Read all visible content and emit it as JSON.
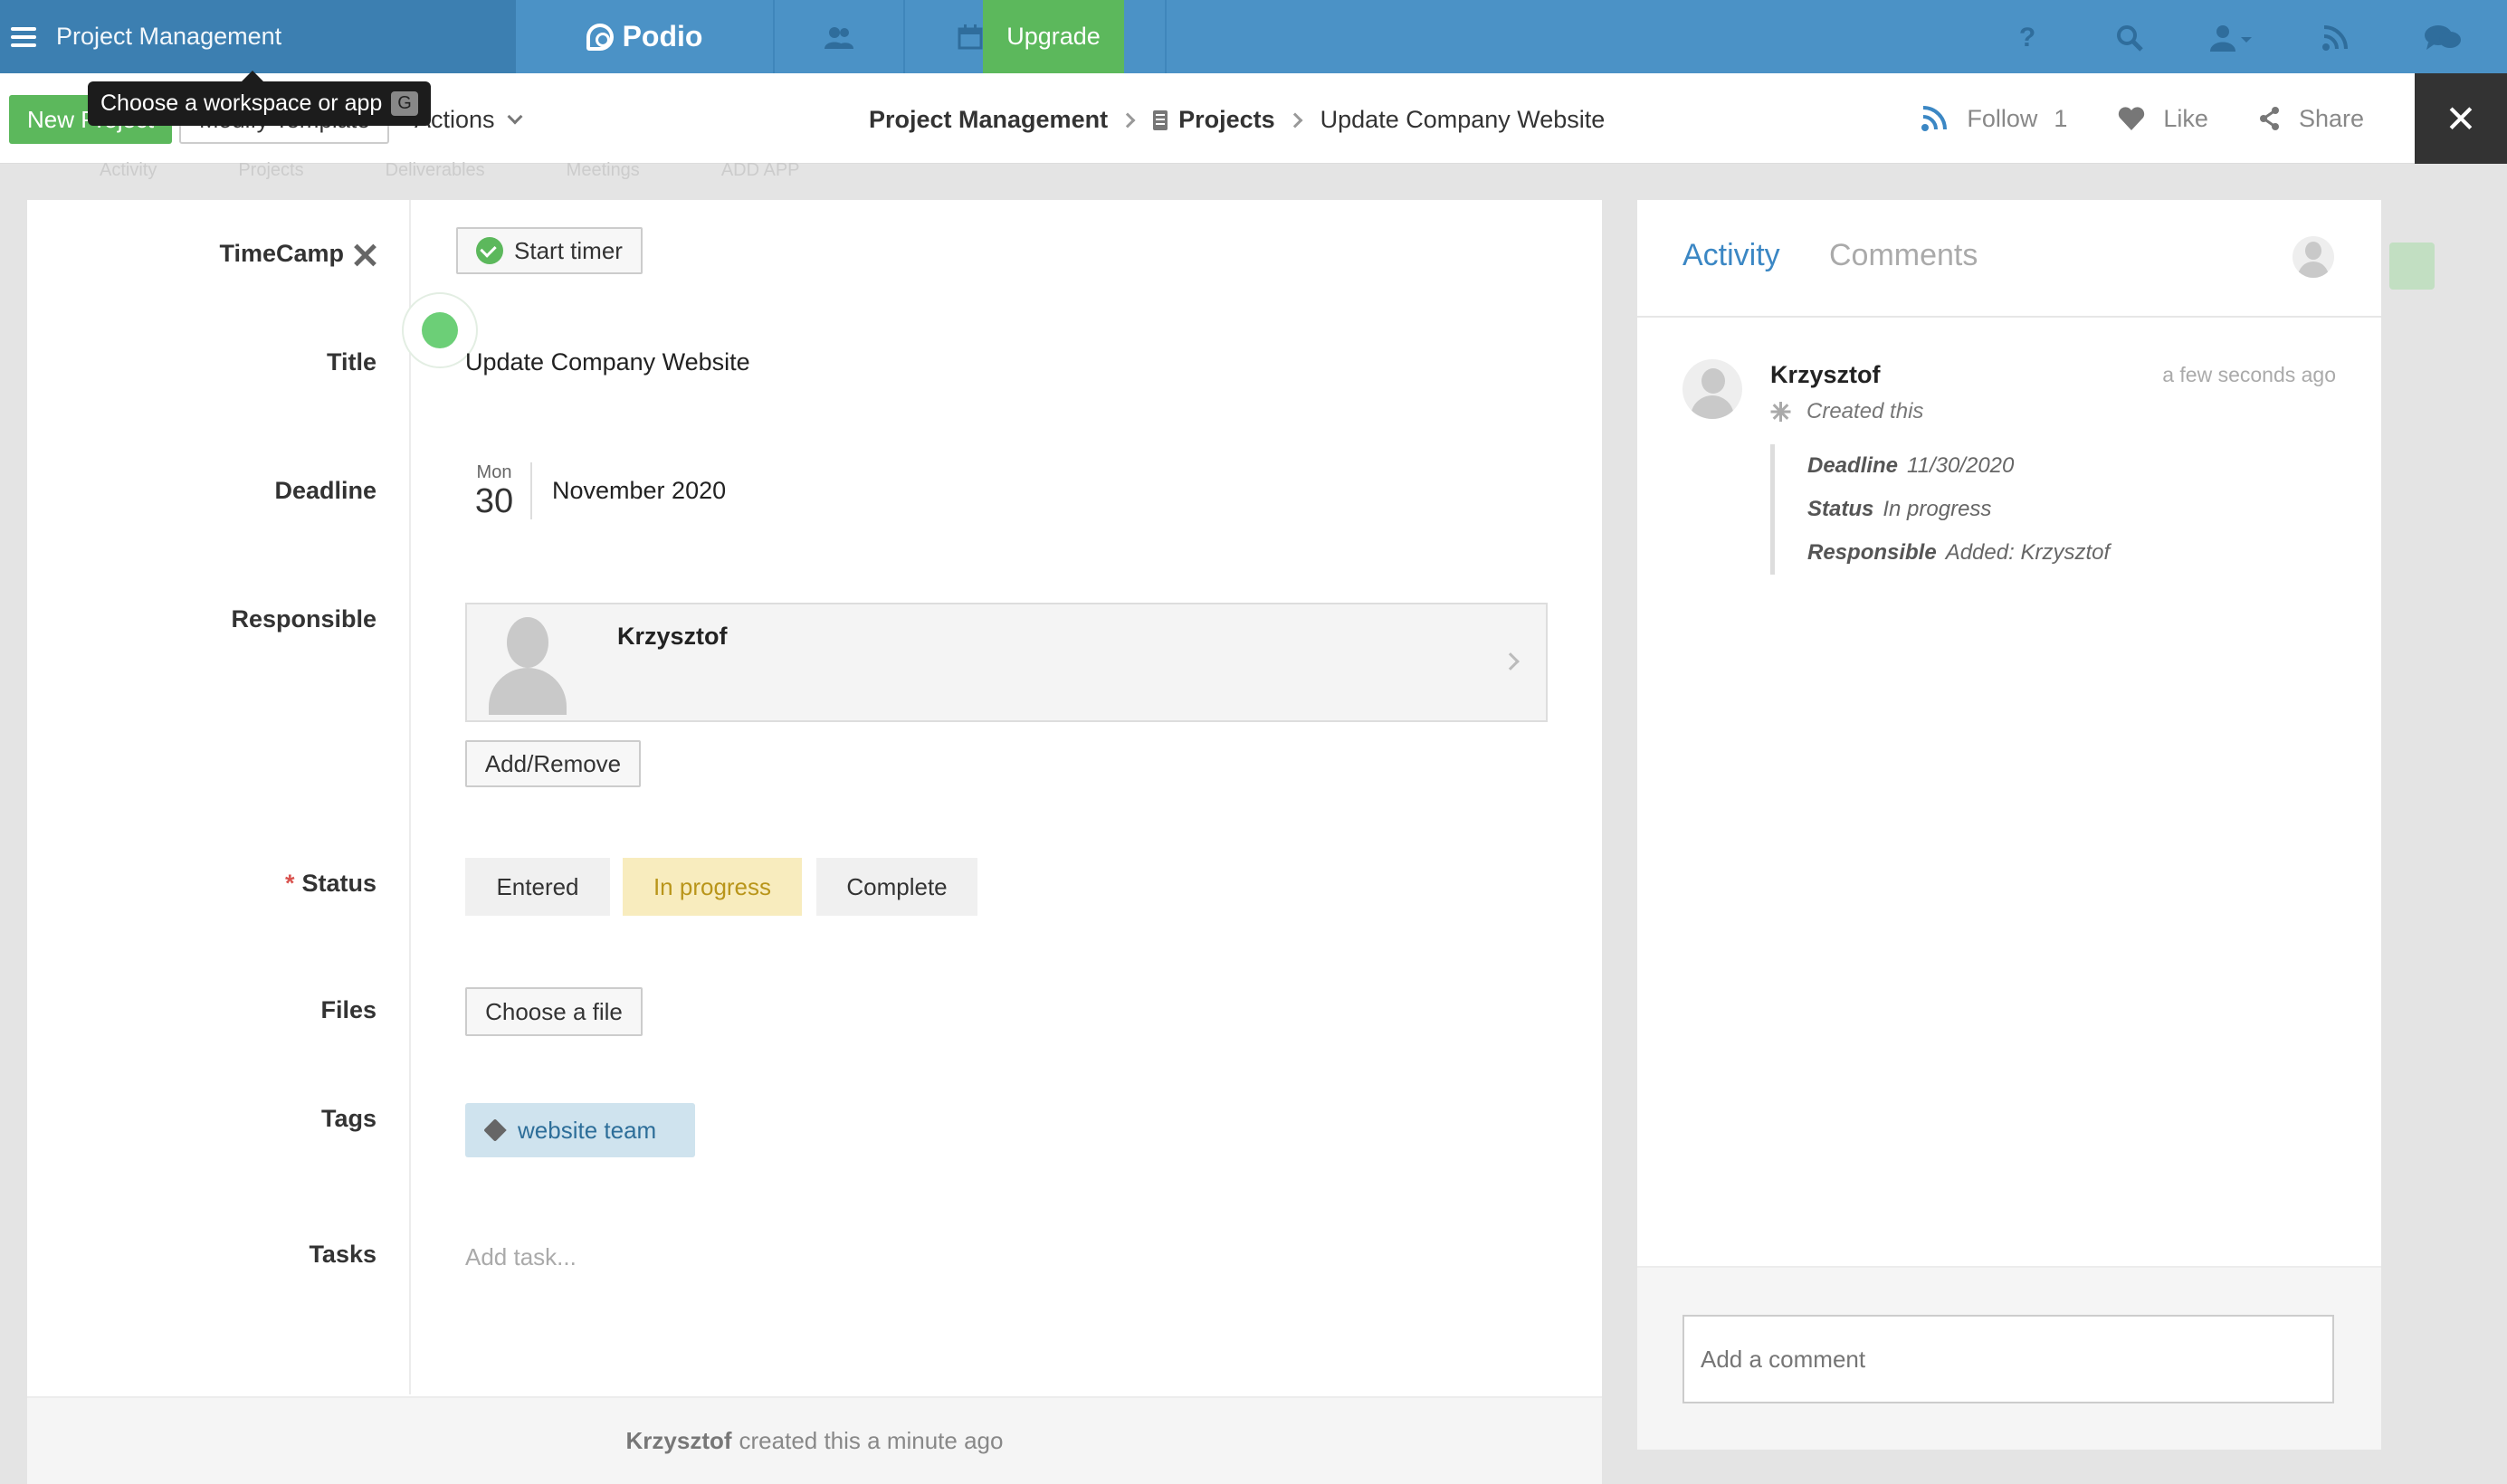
{
  "topbar": {
    "workspace": "Project Management",
    "logo": "Podio",
    "upgrade": "Upgrade",
    "icons": [
      "people-icon",
      "calendar-icon",
      "tasks-icon",
      "help-icon",
      "search-icon",
      "user-icon",
      "activity-feed-icon",
      "chat-icon"
    ]
  },
  "tooltip": {
    "text": "Choose a workspace or app",
    "shortcut": "G"
  },
  "subbar": {
    "new_button": "New Project",
    "modify_button": "Modify Template",
    "actions": "Actions",
    "breadcrumb": [
      "Project Management",
      "Projects",
      "Update Company Website"
    ],
    "follow": "Follow",
    "follow_count": "1",
    "like": "Like",
    "share": "Share",
    "close": "✕"
  },
  "background_tabs": [
    "Activity",
    "Projects",
    "Deliverables",
    "Meetings",
    "ADD APP"
  ],
  "item": {
    "labels": {
      "timecamp": "TimeCamp",
      "title": "Title",
      "deadline": "Deadline",
      "responsible": "Responsible",
      "status": "Status",
      "files": "Files",
      "tags": "Tags",
      "tasks": "Tasks"
    },
    "required_mark": "*",
    "start_timer": "Start timer",
    "title_value": "Update Company Website",
    "deadline": {
      "weekday": "Mon",
      "day": "30",
      "month_year": "November 2020"
    },
    "responsible": {
      "name": "Krzysztof",
      "add_remove": "Add/Remove"
    },
    "status_options": [
      "Entered",
      "In progress",
      "Complete"
    ],
    "status_selected": "In progress",
    "files_button": "Choose a file",
    "tags": [
      "website team"
    ],
    "tasks_placeholder": "Add task...",
    "footer": {
      "user": "Krzysztof",
      "text": "created this a minute ago"
    }
  },
  "activity": {
    "tabs": [
      "Activity",
      "Comments"
    ],
    "active_tab": "Activity",
    "entry": {
      "user": "Krzysztof",
      "time": "a few seconds ago",
      "action": "Created this",
      "changes": [
        {
          "field": "Deadline",
          "value": "11/30/2020"
        },
        {
          "field": "Status",
          "value": "In progress"
        },
        {
          "field": "Responsible",
          "value": "Added: Krzysztof"
        }
      ]
    },
    "comment_placeholder": "Add a comment"
  },
  "colors": {
    "topbar": "#4b92c6",
    "accent_green": "#5cb85c",
    "link_blue": "#3b87c4",
    "status_active_bg": "#f8ecbe",
    "tag_bg": "#cfe3ee"
  }
}
